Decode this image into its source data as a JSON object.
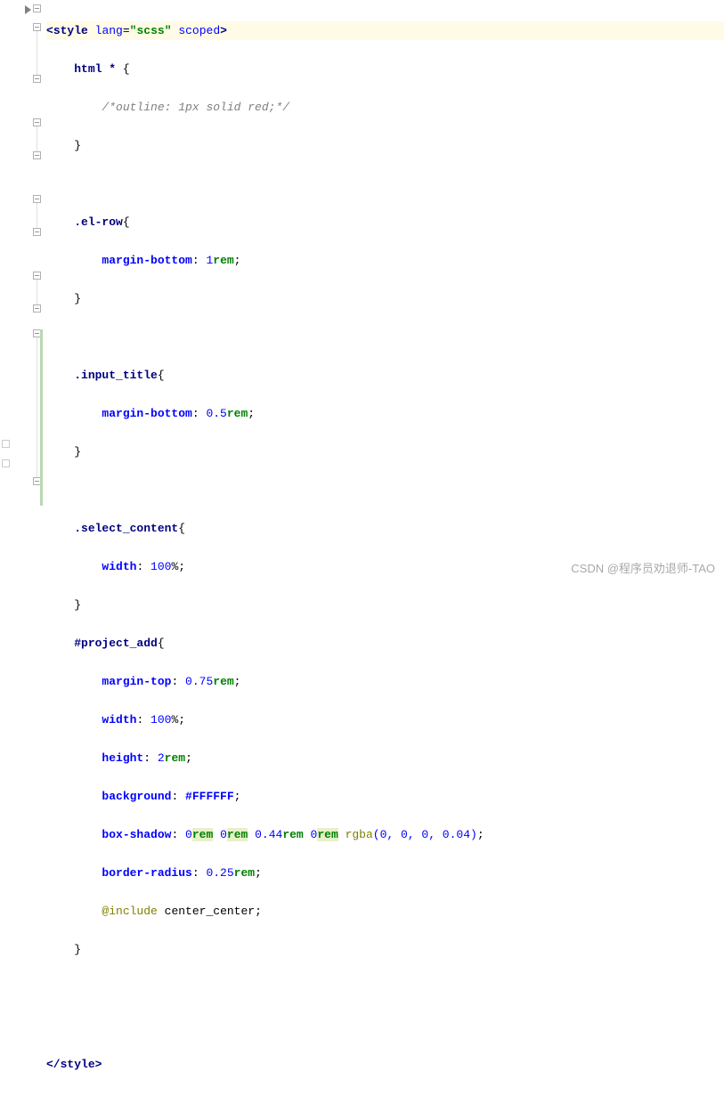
{
  "lines": {
    "l1": {
      "open_tag1": "<",
      "tag": "style",
      "sp": " ",
      "attr1": "lang",
      "eq1": "=",
      "q1a": "\"",
      "val1": "scss",
      "q1b": "\"",
      "sp2": " ",
      "attr2": "scoped",
      "close": ">"
    },
    "l2": {
      "indent": "    ",
      "sel": "html *",
      "sp": " ",
      "brace": "{"
    },
    "l3": {
      "indent": "        ",
      "comment": "/*outline: 1px solid red;*/"
    },
    "l4": {
      "indent": "    ",
      "brace": "}"
    },
    "l5": "",
    "l6": {
      "indent": "    ",
      "sel": ".el-row",
      "brace": "{"
    },
    "l7": {
      "indent": "        ",
      "prop": "margin-bottom",
      "colon": ": ",
      "num": "1",
      "unit": "rem",
      "semi": ";"
    },
    "l8": {
      "indent": "    ",
      "brace": "}"
    },
    "l9": "",
    "l10": {
      "indent": "    ",
      "sel": ".input_title",
      "brace": "{"
    },
    "l11": {
      "indent": "        ",
      "prop": "margin-bottom",
      "colon": ": ",
      "num": "0.5",
      "unit": "rem",
      "semi": ";"
    },
    "l12": {
      "indent": "    ",
      "brace": "}"
    },
    "l13": "",
    "l14": {
      "indent": "    ",
      "sel": ".select_content",
      "brace": "{"
    },
    "l15": {
      "indent": "        ",
      "prop": "width",
      "colon": ": ",
      "num": "100",
      "unit": "%",
      "semi": ";"
    },
    "l16": {
      "indent": "    ",
      "brace": "}"
    },
    "l17": {
      "indent": "    ",
      "sel": "#project_add",
      "brace": "{"
    },
    "l18": {
      "indent": "        ",
      "prop": "margin-top",
      "colon": ": ",
      "num": "0.75",
      "unit": "rem",
      "semi": ";"
    },
    "l19": {
      "indent": "        ",
      "prop": "width",
      "colon": ": ",
      "num": "100",
      "unit": "%",
      "semi": ";"
    },
    "l20": {
      "indent": "        ",
      "prop": "height",
      "colon": ": ",
      "num": "2",
      "unit": "rem",
      "semi": ";"
    },
    "l21": {
      "indent": "        ",
      "prop": "background",
      "colon": ": ",
      "hex": "#FFFFFF",
      "semi": ";"
    },
    "l22": {
      "indent": "        ",
      "prop": "box-shadow",
      "colon": ": ",
      "n1": "0",
      "u1": "rem",
      "sp1": " ",
      "n2": "0",
      "u2": "rem",
      "sp2": " ",
      "n3": "0.44",
      "u3": "rem",
      "sp3": " ",
      "n4": "0",
      "u4": "rem",
      "sp4": " ",
      "fn": "rgba",
      "args": "(0, 0, 0, 0.04)",
      "semi": ";"
    },
    "l23": {
      "indent": "        ",
      "prop": "border-radius",
      "colon": ": ",
      "num": "0.25",
      "unit": "rem",
      "semi": ";"
    },
    "l24": {
      "indent": "        ",
      "at": "@include",
      "sp": " ",
      "mixin": "center_center",
      "semi": ";"
    },
    "l25": {
      "indent": "    ",
      "brace": "}"
    },
    "l26": "",
    "l27": "",
    "l28": {
      "open": "</",
      "tag": "style",
      "close": ">"
    }
  },
  "watermark": "CSDN @程序员劝退师-TAO"
}
